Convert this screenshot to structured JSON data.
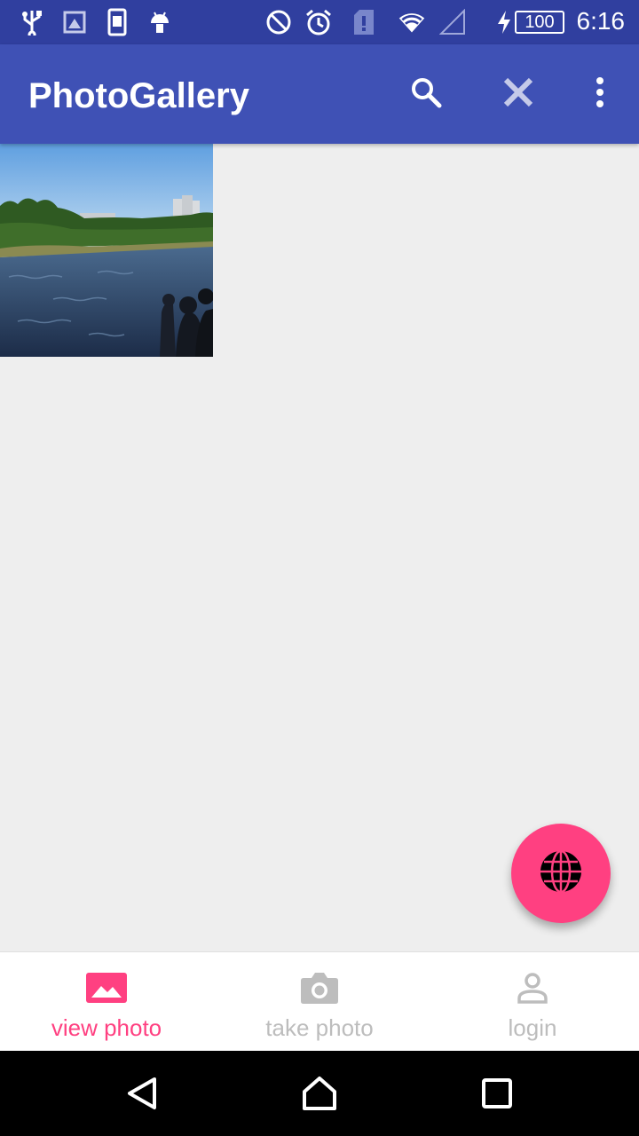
{
  "status_bar": {
    "time": "6:16",
    "battery_level": "100",
    "icons": [
      "usb-icon",
      "photo-notification-icon",
      "screenshot-icon",
      "android-icon",
      "do-not-disturb-icon",
      "alarm-icon",
      "sim-alert-icon",
      "wifi-icon",
      "signal-icon",
      "charging-icon",
      "battery-icon"
    ]
  },
  "app_bar": {
    "title": "PhotoGallery",
    "actions": [
      "search-icon",
      "close-icon",
      "more-vert-icon"
    ]
  },
  "photos": [
    {
      "name": "photo-thumbnail",
      "subject": "lake-with-trees-and-people"
    }
  ],
  "fab": {
    "icon": "globe-icon"
  },
  "bottom_nav": {
    "items": [
      {
        "label": "view photo",
        "icon": "image-icon",
        "active": true
      },
      {
        "label": "take photo",
        "icon": "camera-icon",
        "active": false
      },
      {
        "label": "login",
        "icon": "person-icon",
        "active": false
      }
    ]
  },
  "colors": {
    "status_bar": "#303f9f",
    "app_bar": "#3f51b5",
    "accent": "#ff4081",
    "inactive": "#bdbdbd",
    "background": "#eeeeee"
  },
  "system_nav": [
    "back-icon",
    "home-icon",
    "recents-icon"
  ]
}
